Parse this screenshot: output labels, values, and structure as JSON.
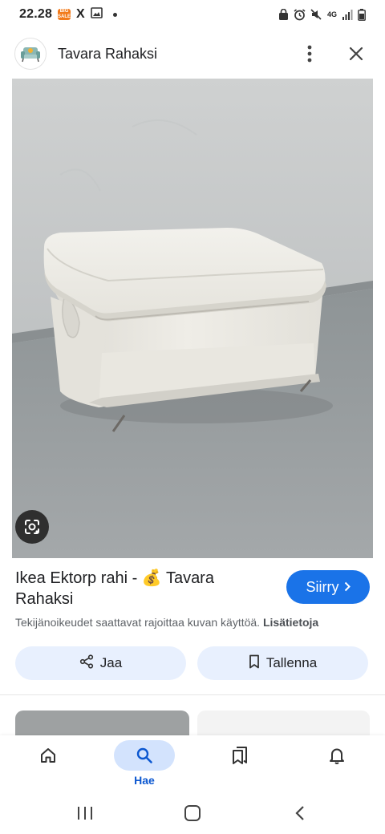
{
  "status_bar": {
    "time": "22.28",
    "badge_text": "BIG SALE",
    "x_app": "X",
    "network": "4G"
  },
  "header": {
    "site_name": "Tavara Rahaksi",
    "site_logo_icon": "armchair-logo-icon",
    "more_icon": "more-vert-icon",
    "close_icon": "close-icon"
  },
  "image": {
    "lens_icon": "google-lens-icon"
  },
  "result": {
    "title": "Ikea Ektorp rahi - 💰 Tavara Rahaksi",
    "goto_label": "Siirry",
    "copyright_text": "Tekijänoikeudet saattavat rajoittaa kuvan käyttöä.",
    "more_info": "Lisätietoja"
  },
  "actions": {
    "share_label": "Jaa",
    "save_label": "Tallenna"
  },
  "bottom_nav": {
    "search_label": "Hae"
  },
  "colors": {
    "accent": "#1a73e8",
    "action_bg": "#e8f0fe",
    "nav_active_bg": "#d3e3fd",
    "nav_label": "#0b57d0"
  }
}
